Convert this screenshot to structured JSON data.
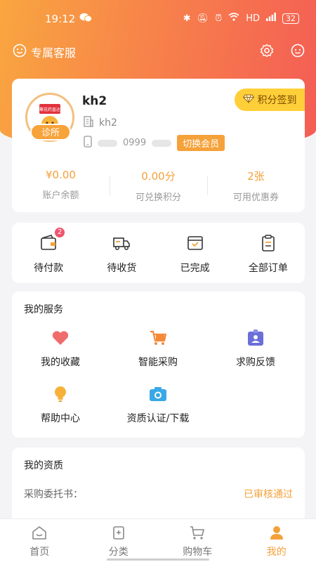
{
  "colors": {
    "accent": "#f4a13a",
    "header_start": "#f9a640",
    "header_end": "#f45d55",
    "badge": "#f0546c"
  },
  "status_bar": {
    "time": "19:12",
    "network": "HD",
    "battery": "32"
  },
  "topbar": {
    "service_label": "专属客服",
    "icons": [
      "smile-icon",
      "settings-icon",
      "message-icon"
    ]
  },
  "profile": {
    "avatar_label": "诊所",
    "avatar_sign": "聚花药直达",
    "username": "kh2",
    "company": "kh2",
    "phone_visible": "0999",
    "switch_member": "切换会员",
    "signin_label": "积分签到"
  },
  "stats": [
    {
      "value": "¥0.00",
      "label": "账户余额"
    },
    {
      "value": "0.00分",
      "label": "可兑换积分"
    },
    {
      "value": "2张",
      "label": "可用优惠券"
    }
  ],
  "orders": [
    {
      "label": "待付款",
      "icon": "wallet-icon",
      "badge": "2"
    },
    {
      "label": "待收货",
      "icon": "truck-icon",
      "badge": ""
    },
    {
      "label": "已完成",
      "icon": "box-done-icon",
      "badge": ""
    },
    {
      "label": "全部订单",
      "icon": "clipboard-icon",
      "badge": ""
    }
  ],
  "services": {
    "title": "我的服务",
    "items": [
      {
        "label": "我的收藏",
        "icon": "heart-icon"
      },
      {
        "label": "智能采购",
        "icon": "cart-icon"
      },
      {
        "label": "求购反馈",
        "icon": "feedback-icon"
      },
      {
        "label": "帮助中心",
        "icon": "bulb-icon"
      },
      {
        "label": "资质认证/下载",
        "icon": "camera-icon"
      }
    ]
  },
  "qualification": {
    "title": "我的资质",
    "row": {
      "key": "采购委托书：",
      "value": "已审核通过"
    }
  },
  "tabbar": [
    {
      "label": "首页",
      "icon": "home-icon",
      "active": false
    },
    {
      "label": "分类",
      "icon": "category-icon",
      "active": false
    },
    {
      "label": "购物车",
      "icon": "cart-icon",
      "active": false
    },
    {
      "label": "我的",
      "icon": "user-icon",
      "active": true
    }
  ]
}
